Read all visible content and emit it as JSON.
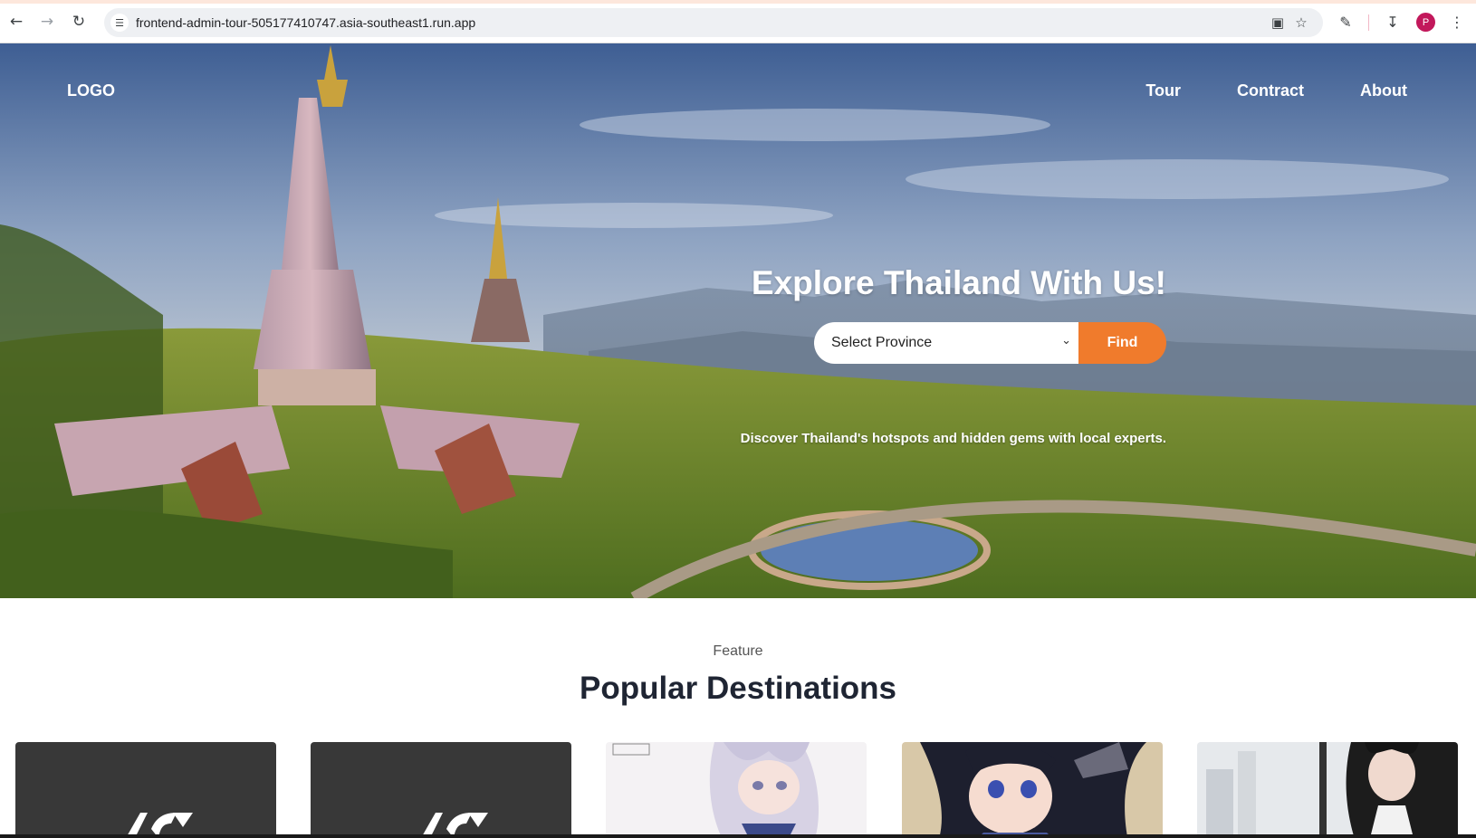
{
  "browser": {
    "url": "frontend-admin-tour-505177410747.asia-southeast1.run.app",
    "avatar_letter": "P",
    "icons": [
      "back-icon",
      "forward-icon",
      "reload-icon",
      "site-settings-icon",
      "install-icon",
      "bookmark-star-icon",
      "extensions-icon",
      "download-icon",
      "menu-icon"
    ]
  },
  "nav": {
    "logo": "LOGO",
    "links": [
      "Tour",
      "Contract",
      "About"
    ]
  },
  "hero": {
    "title": "Explore Thailand With Us!",
    "select_value": "Select Province",
    "find_label": "Find",
    "subtitle": "Discover Thailand's hotspots and hidden gems with local experts."
  },
  "feature": {
    "label": "Feature",
    "title": "Popular Destinations"
  },
  "colors": {
    "accent": "#f07b2c",
    "title": "#1f2533"
  }
}
